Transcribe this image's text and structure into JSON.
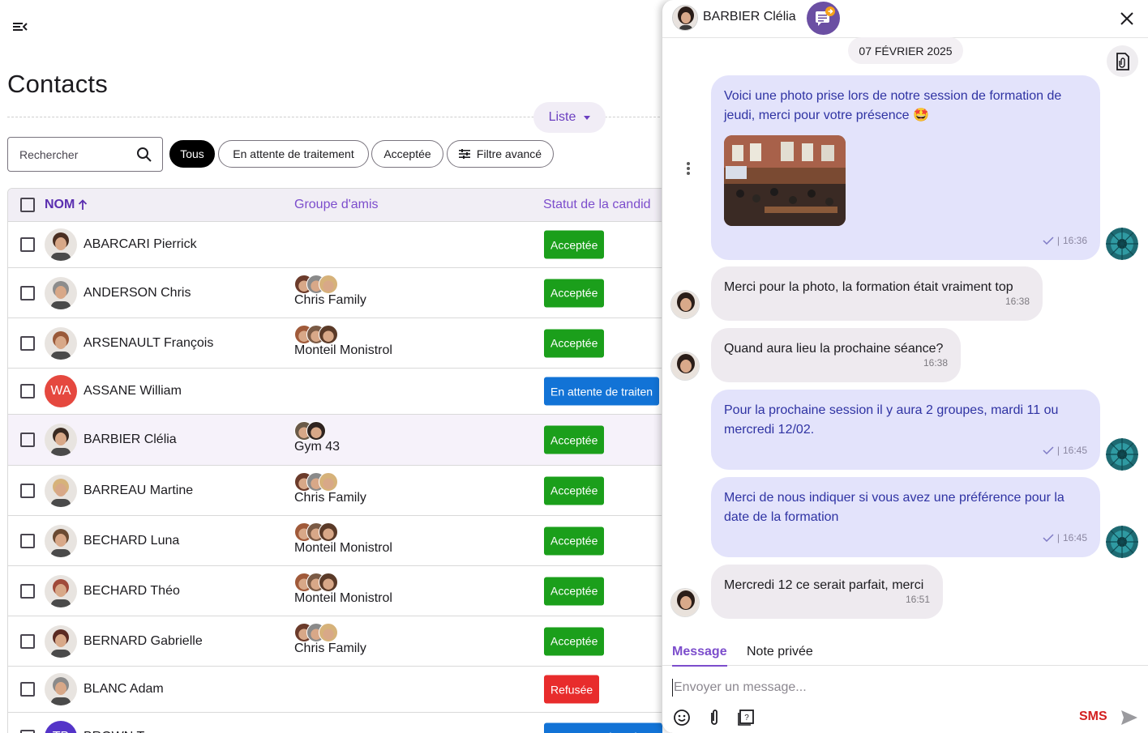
{
  "page": {
    "title": "Contacts",
    "view_label": "Liste"
  },
  "filters": {
    "search_placeholder": "Rechercher",
    "chips": [
      "Tous",
      "En attente de traitement",
      "Acceptée",
      "Filtre avancé"
    ]
  },
  "table": {
    "columns": {
      "name": "NOM",
      "group": "Groupe d'amis",
      "status": "Statut de la candid"
    },
    "rows": [
      {
        "name": "ABARCARI Pierrick",
        "initials": "",
        "group": "",
        "status": "Acceptée",
        "status_type": "ok",
        "face": "#4a2f22"
      },
      {
        "name": "ANDERSON Chris",
        "initials": "",
        "group": "Chris Family",
        "status": "Acceptée",
        "status_type": "ok",
        "face": "#8d8d8d"
      },
      {
        "name": "ARSENAULT François",
        "initials": "",
        "group": "Monteil Monistrol",
        "status": "Acceptée",
        "status_type": "ok",
        "face": "#9a5a3a"
      },
      {
        "name": "ASSANE William",
        "initials": "WA",
        "group": "",
        "status": "En attente de traiten",
        "status_type": "wait",
        "face": ""
      },
      {
        "name": "BARBIER Clélia",
        "initials": "",
        "group": "Gym 43",
        "status": "Acceptée",
        "status_type": "ok",
        "face": "#3a2a22"
      },
      {
        "name": "BARREAU Martine",
        "initials": "",
        "group": "Chris Family",
        "status": "Acceptée",
        "status_type": "ok",
        "face": "#d6b27a"
      },
      {
        "name": "BECHARD Luna",
        "initials": "",
        "group": "Monteil Monistrol",
        "status": "Acceptée",
        "status_type": "ok",
        "face": "#6a4a32"
      },
      {
        "name": "BECHARD Théo",
        "initials": "",
        "group": "Monteil Monistrol",
        "status": "Acceptée",
        "status_type": "ok",
        "face": "#a04a3a"
      },
      {
        "name": "BERNARD Gabrielle",
        "initials": "",
        "group": "Chris Family",
        "status": "Acceptée",
        "status_type": "ok",
        "face": "#5a2a22"
      },
      {
        "name": "BLANC Adam",
        "initials": "",
        "group": "",
        "status": "Refusée",
        "status_type": "ref",
        "face": "#8a8a8a"
      },
      {
        "name": "BROWN T…",
        "initials": "TB",
        "group": "",
        "status": "En attente de traitem",
        "status_type": "wait",
        "face": ""
      }
    ]
  },
  "chat": {
    "contact_name": "BARBIER Clélia",
    "date": "07 FÉVRIER 2025",
    "messages": [
      {
        "dir": "out",
        "text": "Voici une photo prise lors de notre session de formation de jeudi, merci pour votre présence 🤩",
        "time": "16:36",
        "has_photo": true
      },
      {
        "dir": "in",
        "text": "Merci pour la photo, la formation était vraiment top",
        "time": "16:38"
      },
      {
        "dir": "in",
        "text": "Quand aura lieu la prochaine séance?",
        "time": "16:38"
      },
      {
        "dir": "out",
        "text": "Pour la prochaine session il y aura 2 groupes, mardi 11 ou mercredi 12/02.",
        "time": "16:45"
      },
      {
        "dir": "out",
        "text": "Merci de nous indiquer si vous avez une préférence pour la date de la formation",
        "time": "16:45"
      },
      {
        "dir": "in",
        "text": "Mercredi 12 ce serait parfait, merci",
        "time": "16:51"
      }
    ],
    "tabs": [
      "Message",
      "Note privée"
    ],
    "composer_placeholder": "Envoyer un message...",
    "sms_label": "SMS",
    "colors": {
      "accent": "#7c4dcc",
      "sms": "#d32020"
    }
  }
}
